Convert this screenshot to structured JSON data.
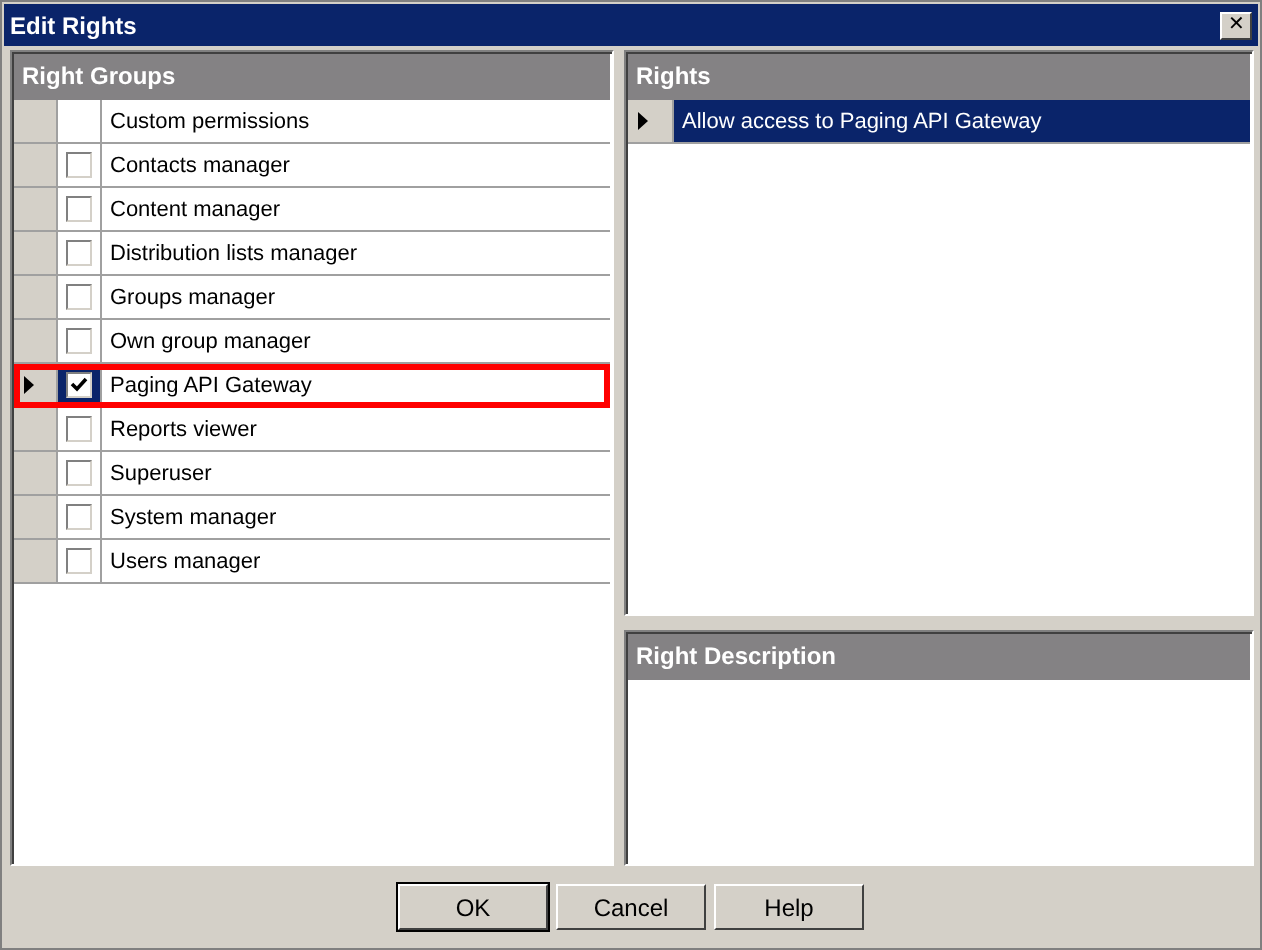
{
  "window": {
    "title": "Edit Rights",
    "close": "✕"
  },
  "right_groups": {
    "title": "Right Groups",
    "rows": [
      {
        "kind": "label",
        "label": "Custom permissions",
        "selected": false
      },
      {
        "kind": "check",
        "label": "Contacts manager",
        "checked": false,
        "selected": false
      },
      {
        "kind": "check",
        "label": "Content manager",
        "checked": false,
        "selected": false
      },
      {
        "kind": "check",
        "label": "Distribution lists manager",
        "checked": false,
        "selected": false
      },
      {
        "kind": "check",
        "label": "Groups manager",
        "checked": false,
        "selected": false
      },
      {
        "kind": "check",
        "label": "Own group manager",
        "checked": false,
        "selected": false
      },
      {
        "kind": "check",
        "label": "Paging API Gateway",
        "checked": true,
        "selected": true
      },
      {
        "kind": "check",
        "label": "Reports viewer",
        "checked": false,
        "selected": false
      },
      {
        "kind": "check",
        "label": "Superuser",
        "checked": false,
        "selected": false
      },
      {
        "kind": "check",
        "label": "System manager",
        "checked": false,
        "selected": false
      },
      {
        "kind": "check",
        "label": "Users manager",
        "checked": false,
        "selected": false
      }
    ]
  },
  "rights": {
    "title": "Rights",
    "rows": [
      {
        "label": "Allow access to Paging API Gateway",
        "selected": true
      }
    ]
  },
  "right_description": {
    "title": "Right Description"
  },
  "buttons": [
    {
      "label": "OK",
      "default": true
    },
    {
      "label": "Cancel",
      "default": false
    },
    {
      "label": "Help",
      "default": false
    }
  ]
}
